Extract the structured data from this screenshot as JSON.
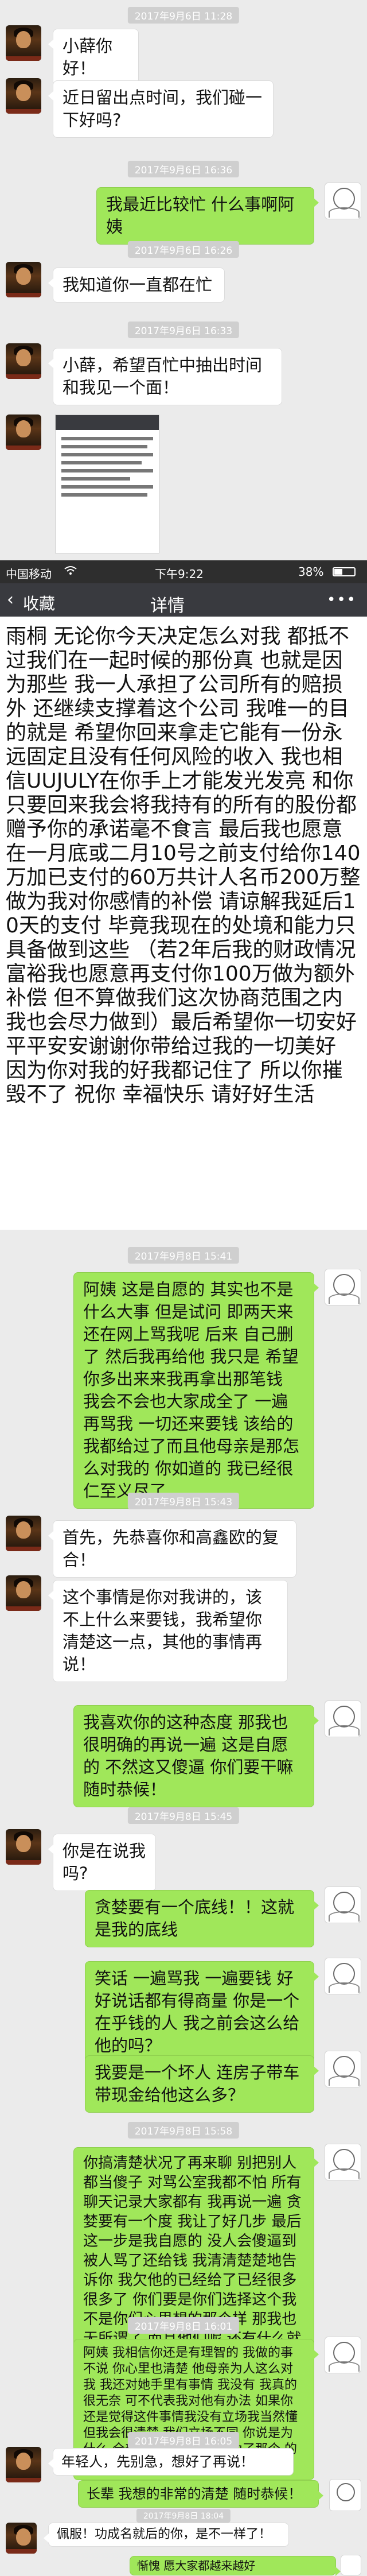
{
  "messages": {
    "ts1": "2017年9月6日 11:28",
    "m1": "小薛你好！",
    "m2": "近日留出点时间，我们碰一下好吗?",
    "ts2": "2017年9月6日 16:36",
    "m3": "我最近比较忙 什么事啊阿姨",
    "ts3": "2017年9月6日 16:26",
    "m4": "我知道你一直都在忙",
    "ts4": "2017年9月6日 16:33",
    "m5": "小薛，希望百忙中抽出时间和我见一个面！",
    "ts5": "2017年9月8日 15:41",
    "m6": "阿姨 这是自愿的 其实也不是什么大事 但是试问 即两天来 还在网上骂我呢 后来 自己删了 然后我再给他 我只是 希望 你多出来来我再拿出那笔钱 我会不会也大家成全了 一遍再骂我 一切还来要钱 该给的我都给过了而且他母亲是那怎么对我的 你如道的 我已经很仁至义尽了",
    "ts6": "2017年9月8日 15:43",
    "m7": "首先，先恭喜你和高鑫欧的复合！",
    "m8": "这个事情是你对我讲的，该不上什么来要钱，我希望你清楚这一点，其他的事情再说！",
    "m9": "我喜欢你的这种态度 那我也很明确的再说一遍 这是自愿的 不然这又傻逼 你们要干嘛 随时恭候！",
    "ts7": "2017年9月8日 15:45",
    "m10": "你是在说我吗?",
    "m11": "贪婪要有一个底线！！这就是我的底线",
    "m12": "笑话 一遍骂我 一遍要钱 好好说话都有得商量 你是一个在乎钱的人 我之前会这么给他的吗？",
    "m13": "我要是一个坏人 连房子带车带现金给他这么多？",
    "ts8": "2017年9月8日 15:58",
    "m14": "你搞清楚状况了再来聊 别把别人都当傻子 对骂公室我都不怕 所有聊天记录大家都有 我再说一遍 贪婪要有一个度 我让了好几步 最后这一步是我自愿的 没人会傻逼到被人骂了还给钱 我清清楚楚地告诉你 我欠他的已经给了已经很多很多了 你们要是你们选择这个我不是你们心里想的那个样 那我也无所谓了 而且他们呢 还有什么就走吧",
    "ts9": "2017年9月8日 16:01",
    "m15": "阿姨 我相信你还是有理智的 我做的事不说 你心里也清楚 他母亲为人这么对我 我还对她手里有事情 我没有 我真的很无奈 可不代表我对他有办法 如果你还是觉得这件事情我没有立场我当然懂 但我会很清楚 我们立场不同 你说是为什么 全部都是好的 我都是为了那个 的不会再多给啥 希望你懂",
    "ts10": "2017年9月8日 16:05",
    "m16": "年轻人，先别急，想好了再说！",
    "m17": "长辈 我想的非常的清楚 随时恭候！",
    "ts11": "2017年9月8日 18:04",
    "m18": "佩服！功成名就后的你，是不一样了！",
    "m19": "惭愧 愿大家都越来越好"
  },
  "embedded": {
    "carrier": "中国移动",
    "wifi_icon": "wifi-icon",
    "time": "下午9:22",
    "battery_pct": "38%",
    "back_label": "收藏",
    "title": "详情",
    "body": "雨桐 无论你今天决定怎么对我 都抵不过我们在一起时候的那份真 也就是因为那些 我一人承担了公司所有的赔损外 还继续支撑着这个公司 我唯一的目的就是 希望你回来拿走它能有一份永远固定且没有任何风险的收入 我也相信UUJULY在你手上才能发光发亮 和你只要回来我会将我持有的所有的股份都赠予你的承诺毫不食言 最后我也愿意在一月底或二月10号之前支付给你140万加已支付的60万共计人名币200万整做为我对你感情的补偿 请谅解我延后10天的支付 毕竟我现在的处境和能力只具备做到这些 （若2年后我的财政情况富裕我也愿意再支付你100万做为额外补偿 但不算做我们这次协商范围之内 我也会尽力做到）最后希望你一切安好 平平安安谢谢你带给过我的一切美好 因为你对我的好我都记住了 所以你摧毁不了 祝你 幸福快乐 请好好生活"
  },
  "colors": {
    "outgoing_bubble": "#a0e75a",
    "incoming_bubble": "#ffffff",
    "background": "#ebebeb",
    "navbar": "#393a3f"
  }
}
